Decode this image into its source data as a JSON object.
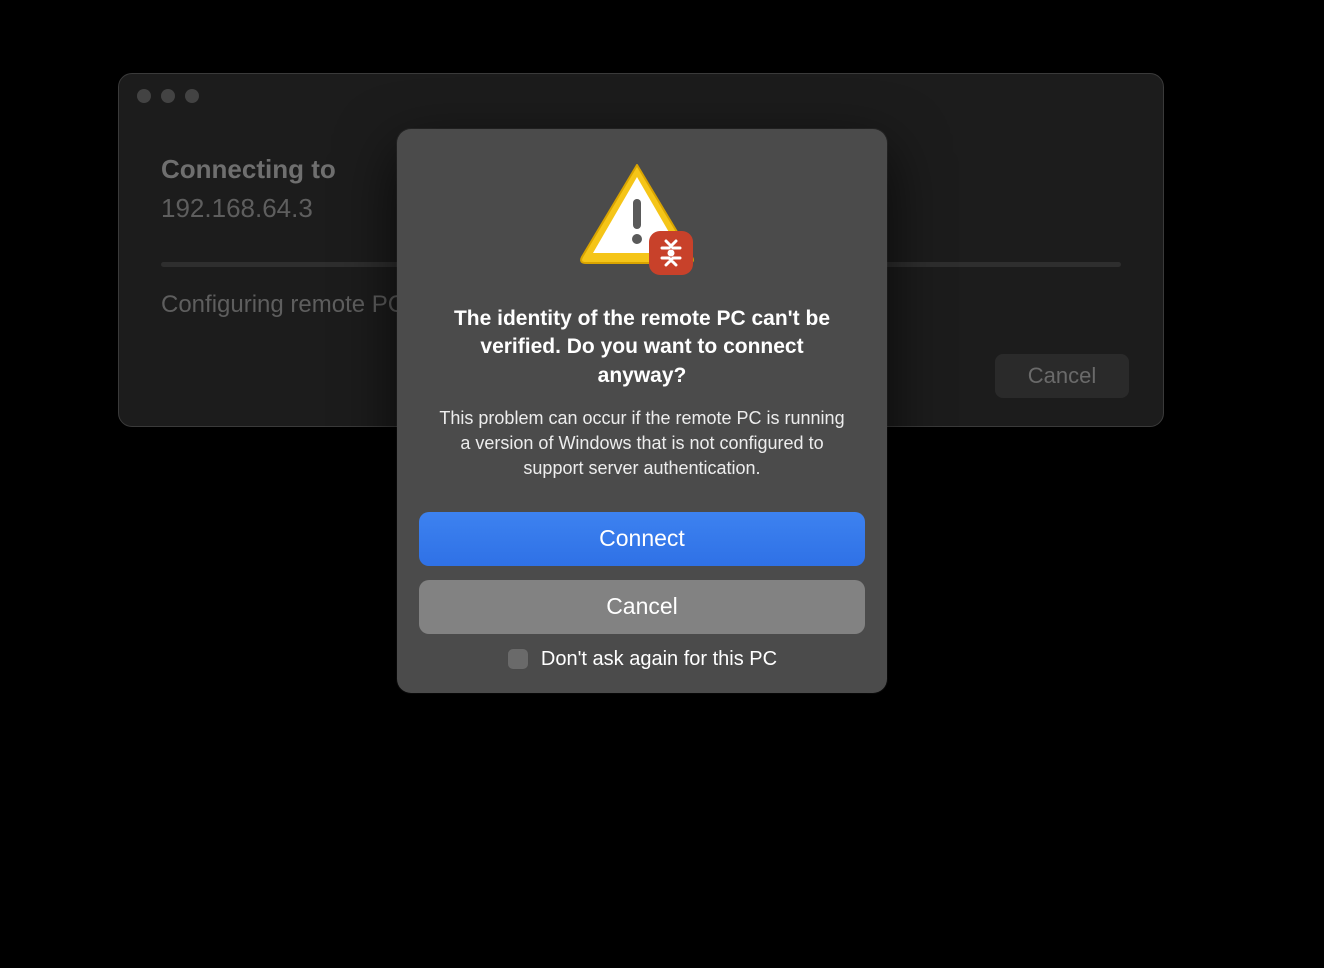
{
  "background_window": {
    "heading": "Connecting to",
    "ip_address": "192.168.64.3",
    "status_text": "Configuring remote PC…",
    "cancel_label": "Cancel",
    "traffic_lights": [
      "close",
      "minimize",
      "zoom"
    ]
  },
  "modal": {
    "icon_semantic": "warning-triangle-with-remote-desktop-badge",
    "title": "The identity of the remote PC can't be verified. Do you want to connect anyway?",
    "description": "This problem can occur if the remote PC is running a version of Windows that is not configured to support server authentication.",
    "connect_label": "Connect",
    "cancel_label": "Cancel",
    "checkbox_label": "Don't ask again for this PC",
    "checkbox_checked": false
  },
  "colors": {
    "primary_button": "#3478F6",
    "secondary_button": "#828282",
    "modal_bg": "#4b4b4b",
    "warning_yellow": "#f5c518",
    "badge_red": "#c8412a"
  }
}
